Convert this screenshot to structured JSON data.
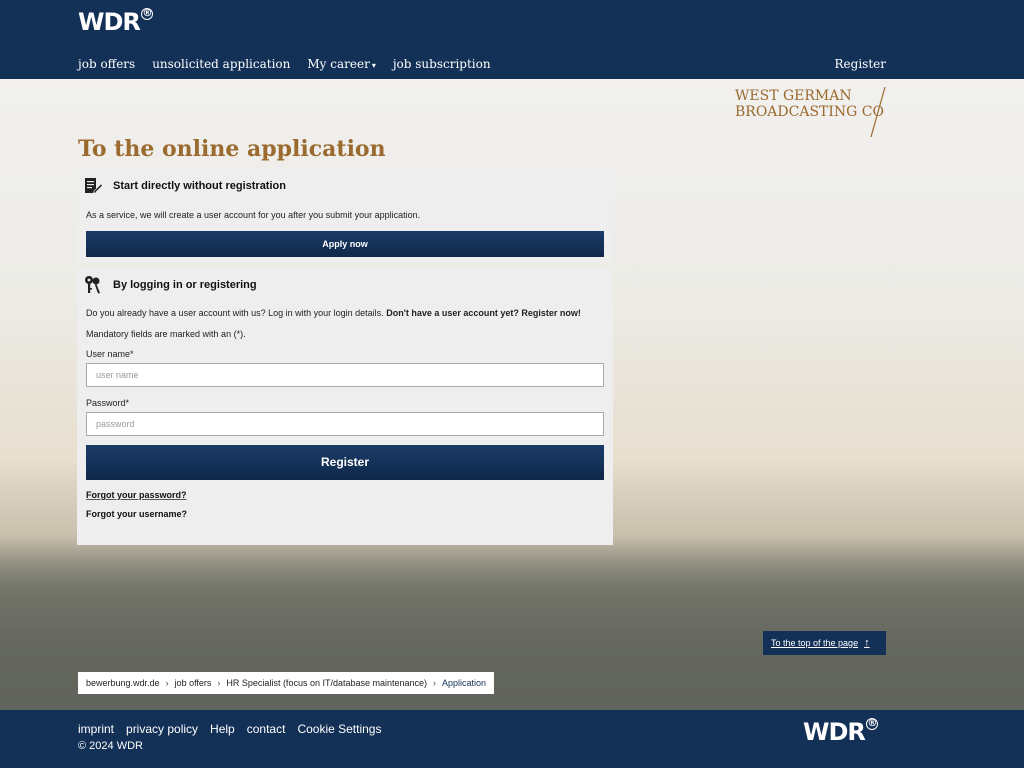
{
  "header": {
    "logo": "WDR",
    "logo_mark": "®",
    "nav": [
      "job offers",
      "unsolicited application",
      "My career",
      "job subscription"
    ],
    "register": "Register"
  },
  "brand": {
    "line1": "WEST GERMAN",
    "line2": "BROADCASTING CO"
  },
  "page_title": "To the online application",
  "panel_direct": {
    "title": "Start directly without registration",
    "text": "As a service, we will create a user account for you after you submit your application.",
    "button": "Apply now"
  },
  "panel_login": {
    "title": "By logging in or registering",
    "intro": "Do you already have a user account with us? Log in with your login details.",
    "intro_bold": "Don't have a user account yet? Register now!",
    "mandatory": "Mandatory fields are marked with an (*).",
    "username_label": "User name*",
    "username_placeholder": "user name",
    "password_label": "Password*",
    "password_placeholder": "password",
    "button": "Register",
    "forgot_password": "Forgot your password?",
    "forgot_username": "Forgot your username?"
  },
  "to_top": "To the top of the page",
  "breadcrumb": [
    "bewerbung.wdr.de",
    "job offers",
    "HR Specialist (focus on IT/database maintenance)",
    "Application"
  ],
  "footer": {
    "links": [
      "imprint",
      "privacy policy",
      "Help",
      "contact",
      "Cookie Settings"
    ],
    "copyright": "© 2024 WDR",
    "logo": "WDR",
    "logo_mark": "®"
  },
  "colors": {
    "navy": "#133057",
    "gold": "#9b6a2e",
    "panel": "#eeeeee"
  }
}
